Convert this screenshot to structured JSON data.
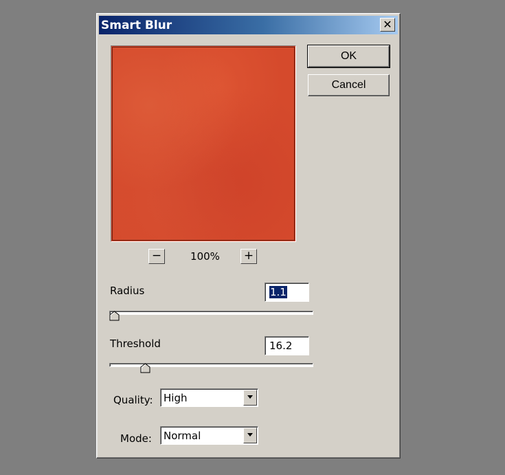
{
  "window": {
    "title": "Smart Blur",
    "close_glyph": "✕"
  },
  "buttons": {
    "ok_label": "OK",
    "cancel_label": "Cancel"
  },
  "preview": {
    "zoom_out_glyph": "−",
    "zoom_in_glyph": "+",
    "zoom_level": "100%",
    "color": "#d54a2c"
  },
  "radius": {
    "label": "Radius",
    "value": "1.1",
    "slider_fraction": 0.0
  },
  "threshold": {
    "label": "Threshold",
    "value": "16.2",
    "slider_fraction": 0.16
  },
  "quality": {
    "label": "Quality:",
    "selected": "High"
  },
  "mode": {
    "label": "Mode:",
    "selected": "Normal"
  },
  "icons": {
    "close": "close-icon",
    "dropdown": "chevron-down-icon",
    "slider_thumb": "slider-thumb-icon"
  }
}
